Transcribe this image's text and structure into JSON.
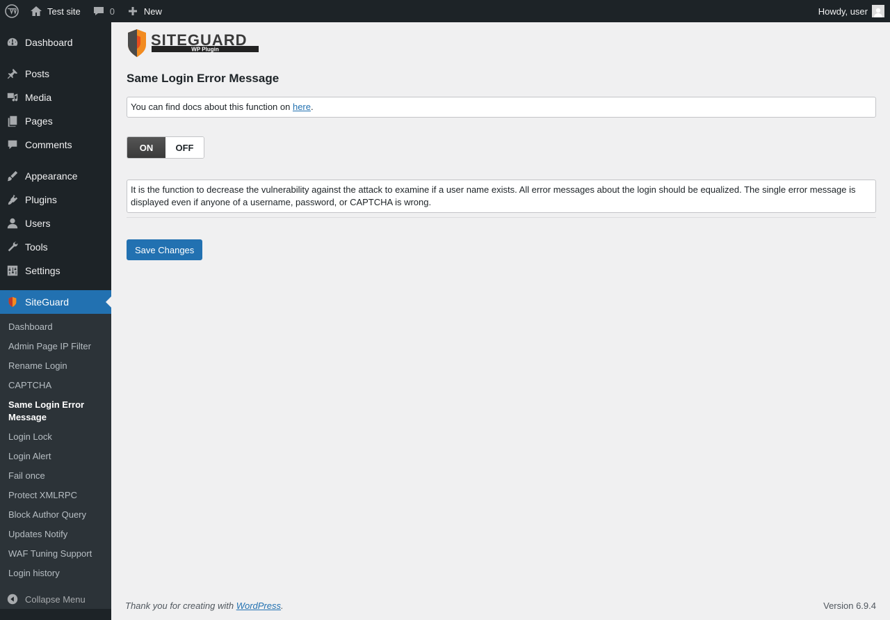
{
  "adminbar": {
    "site_name": "Test site",
    "comments_count": "0",
    "new_label": "New",
    "howdy": "Howdy, user"
  },
  "menu": {
    "items": [
      {
        "label": "Dashboard",
        "icon": "dashboard-icon"
      },
      {
        "label": "Posts",
        "icon": "pin-icon"
      },
      {
        "label": "Media",
        "icon": "media-icon"
      },
      {
        "label": "Pages",
        "icon": "pages-icon"
      },
      {
        "label": "Comments",
        "icon": "comment-icon"
      },
      {
        "label": "Appearance",
        "icon": "brush-icon"
      },
      {
        "label": "Plugins",
        "icon": "plug-icon"
      },
      {
        "label": "Users",
        "icon": "user-icon"
      },
      {
        "label": "Tools",
        "icon": "wrench-icon"
      },
      {
        "label": "Settings",
        "icon": "sliders-icon"
      },
      {
        "label": "SiteGuard",
        "icon": "siteguard-shield-icon",
        "current": true
      }
    ],
    "submenu": [
      "Dashboard",
      "Admin Page IP Filter",
      "Rename Login",
      "CAPTCHA",
      "Same Login Error Message",
      "Login Lock",
      "Login Alert",
      "Fail once",
      "Protect XMLRPC",
      "Block Author Query",
      "Updates Notify",
      "WAF Tuning Support",
      "Login history"
    ],
    "submenu_current": "Same Login Error Message",
    "collapse_label": "Collapse Menu"
  },
  "logo": {
    "brand": "SITEGUARD",
    "tagline": "WP Plugin"
  },
  "page": {
    "title": "Same Login Error Message",
    "docs_prefix": "You can find docs about this function on ",
    "docs_link": "here",
    "docs_suffix": ".",
    "toggle_on": "ON",
    "toggle_off": "OFF",
    "toggle_state": "ON",
    "description": "It is the function to decrease the vulnerability against the attack to examine if a user name exists. All error messages about the login should be equalized. The single error message is displayed even if anyone of a username, password, or CAPTCHA is wrong.",
    "save_label": "Save Changes"
  },
  "footer": {
    "thanks_prefix": "Thank you for creating with ",
    "thanks_link": "WordPress",
    "thanks_suffix": ".",
    "version": "Version 6.9.4"
  },
  "colors": {
    "accent": "#2271b1",
    "sidebar": "#1d2327",
    "submenu": "#2c3338",
    "background": "#f0f0f1"
  }
}
